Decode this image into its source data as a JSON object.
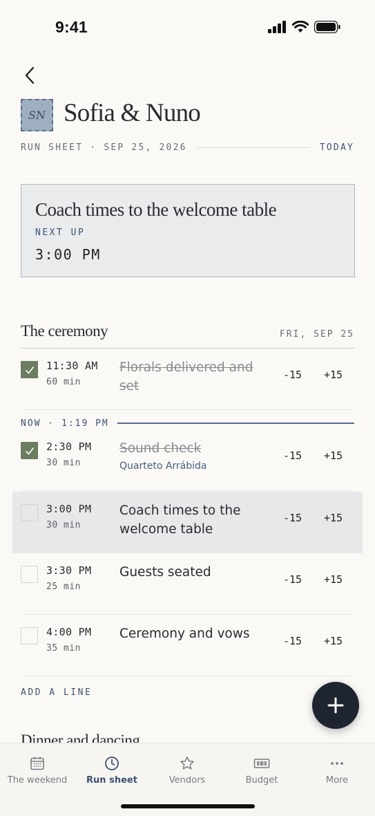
{
  "status_bar": {
    "time": "9:41"
  },
  "header": {
    "monogram": "SN",
    "couple_name": "Sofia & Nuno",
    "sheet_label": "RUN SHEET · SEP 25, 2026",
    "today_label": "TODAY"
  },
  "next_up": {
    "title": "Coach times to the welcome table",
    "kicker": "NEXT UP",
    "time": "3:00 PM"
  },
  "section": {
    "title": "The ceremony",
    "date": "FRI, SEP 25"
  },
  "now_marker": "NOW · 1:19 PM",
  "rows": [
    {
      "time": "11:30 AM",
      "duration": "60 min",
      "title": "Florals delivered and set",
      "vendor": "",
      "done": true,
      "current": false,
      "minus": "-15",
      "plus": "+15"
    },
    {
      "time": "2:30 PM",
      "duration": "30 min",
      "title": "Sound check",
      "vendor": "Quarteto Arrábida",
      "done": true,
      "current": false,
      "minus": "-15",
      "plus": "+15"
    },
    {
      "time": "3:00 PM",
      "duration": "30 min",
      "title": "Coach times to the welcome table",
      "vendor": "",
      "done": false,
      "current": true,
      "minus": "-15",
      "plus": "+15"
    },
    {
      "time": "3:30 PM",
      "duration": "25 min",
      "title": "Guests seated",
      "vendor": "",
      "done": false,
      "current": false,
      "minus": "-15",
      "plus": "+15"
    },
    {
      "time": "4:00 PM",
      "duration": "35 min",
      "title": "Ceremony and vows",
      "vendor": "",
      "done": false,
      "current": false,
      "minus": "-15",
      "plus": "+15"
    }
  ],
  "add_line_label": "ADD A LINE",
  "next_section_title": "Dinner and dancing",
  "tab_bar": {
    "tabs": [
      {
        "label": "The weekend",
        "icon": "calendar-icon",
        "active": false
      },
      {
        "label": "Run sheet",
        "icon": "clock-icon",
        "active": true
      },
      {
        "label": "Vendors",
        "icon": "star-icon",
        "active": false
      },
      {
        "label": "Budget",
        "icon": "banknote-icon",
        "active": false
      },
      {
        "label": "More",
        "icon": "more-icon",
        "active": false
      }
    ]
  },
  "colors": {
    "accent": "#3f5273",
    "checked": "#6c7c5e",
    "background": "#faf9f6",
    "fab": "#1f2530"
  }
}
